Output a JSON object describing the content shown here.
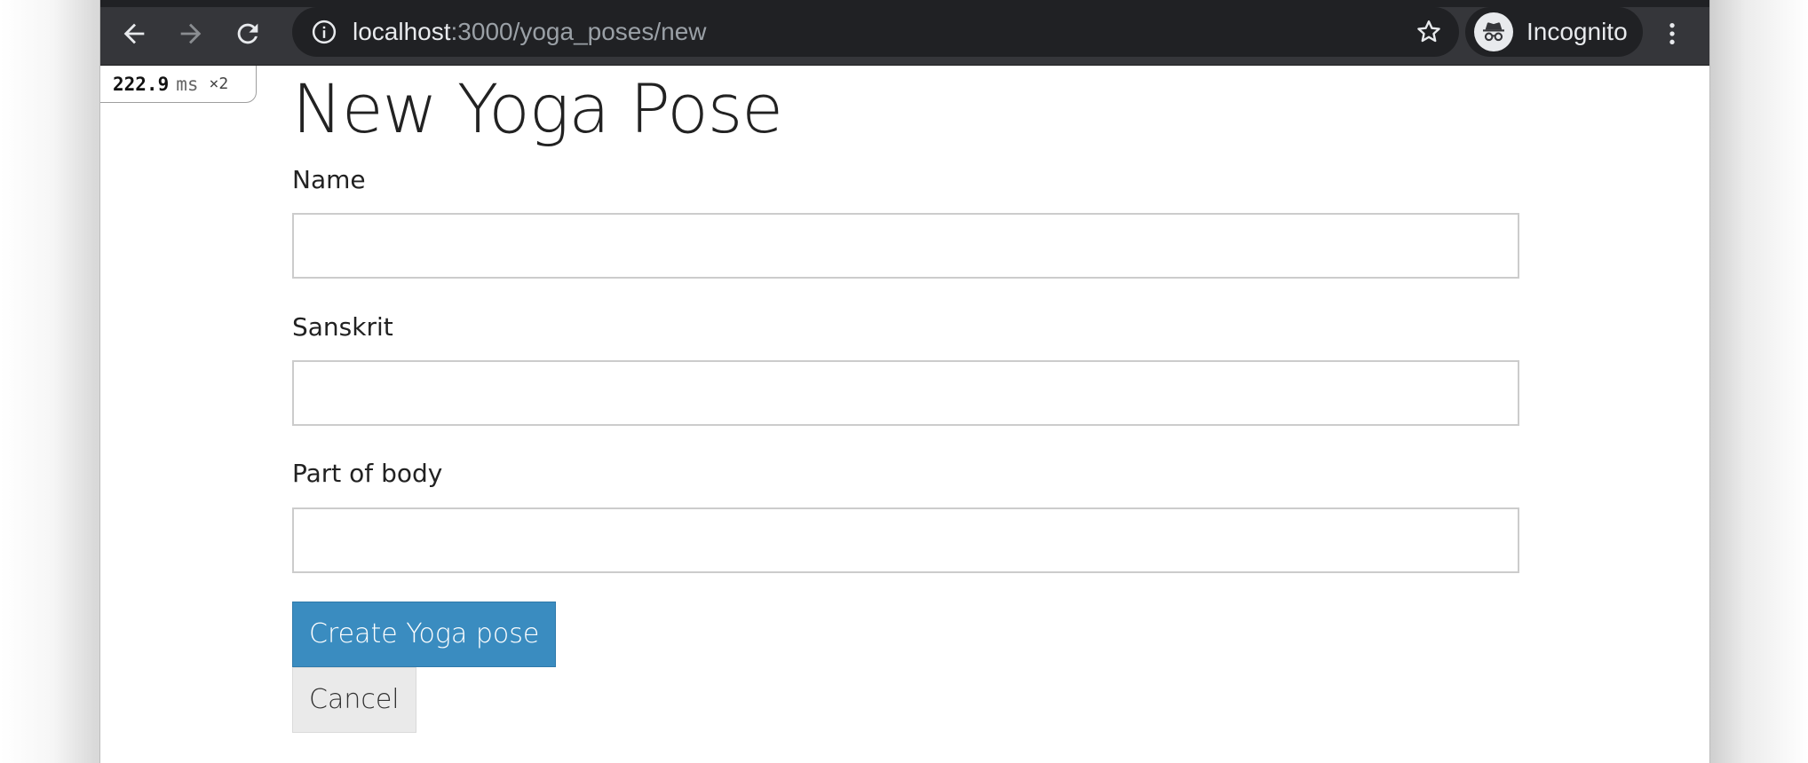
{
  "browser": {
    "url_host": "localhost",
    "url_path": ":3000/yoga_poses/new",
    "profile_label": "Incognito",
    "icons": {
      "back": "arrow-left-icon",
      "forward": "arrow-right-icon",
      "reload": "reload-icon",
      "info": "info-icon",
      "bookmark": "star-icon",
      "incognito": "incognito-icon",
      "menu": "kebab-menu-icon"
    }
  },
  "profiler": {
    "time": "222.9",
    "unit": "ms",
    "count": "×2"
  },
  "page": {
    "title": "New Yoga Pose",
    "fields": [
      {
        "label": "Name",
        "value": ""
      },
      {
        "label": "Sanskrit",
        "value": ""
      },
      {
        "label": "Part of body",
        "value": ""
      }
    ],
    "submit_label": "Create Yoga pose",
    "cancel_label": "Cancel"
  },
  "colors": {
    "toolbar": "#35363a",
    "omnibox": "#202124",
    "primary_button": "#3a8cc0",
    "secondary_button": "#eaeaea"
  }
}
